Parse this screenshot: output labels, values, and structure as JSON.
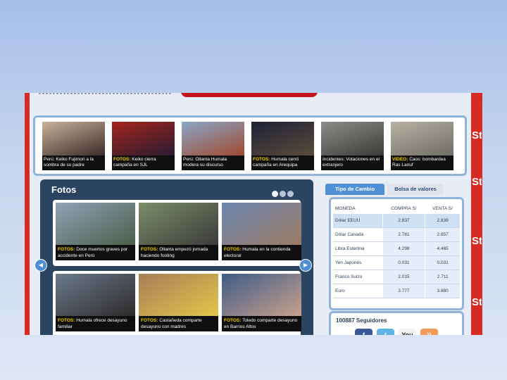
{
  "strip": [
    {
      "text": "Perú: Keiko Fujimori a la sombra de su padre",
      "hl": "",
      "c1": "#c9b39c",
      "c2": "#3b2b2a"
    },
    {
      "text": "Keiko cierra campaña en SJL",
      "hl": "FOTOS:",
      "c1": "#a3241f",
      "c2": "#2a1c30"
    },
    {
      "text": "Perú: Ollanta Humala modera su discurso",
      "hl": "",
      "c1": "#8aa6c9",
      "c2": "#a04a2e"
    },
    {
      "text": "Humala cerró campaña en Arequipa",
      "hl": "FOTOS:",
      "c1": "#1d2236",
      "c2": "#5a4b3b"
    },
    {
      "text": "Incidentes: Votaciones en el extranjero",
      "hl": "",
      "c1": "#8b8f88",
      "c2": "#3b3b38"
    },
    {
      "text": "Caos: bombardea Ras Lanuf",
      "hl": "VIDEO:",
      "c1": "#b8b2a5",
      "c2": "#6f6d66"
    }
  ],
  "side_letters": [
    "St",
    "St",
    "St",
    "St"
  ],
  "fotos": {
    "title": "Fotos",
    "items": [
      {
        "hl": "FOTOS:",
        "text": "Doce muertos graves por accidente en Perú",
        "c1": "#8fa3b5",
        "c2": "#4c5e4a"
      },
      {
        "hl": "FOTOS:",
        "text": "Ollanta empezó jornada haciendo footing",
        "c1": "#7b8d69",
        "c2": "#3b3b3b"
      },
      {
        "hl": "FOTOS:",
        "text": "Humala en la contienda electoral",
        "c1": "#6c87b2",
        "c2": "#9b7a62"
      },
      {
        "hl": "FOTOS:",
        "text": "Humala ofrece desayuno familiar",
        "c1": "#6b7a8c",
        "c2": "#2e2a2a"
      },
      {
        "hl": "FOTOS:",
        "text": "Castañeda comparte desayuno con madres",
        "c1": "#a57f58",
        "c2": "#e2c64a"
      },
      {
        "hl": "FOTOS:",
        "text": "Toledo comparte desayuno en Barrios Altos",
        "c1": "#3e5c88",
        "c2": "#c8a08c"
      }
    ]
  },
  "exchange": {
    "tabs": [
      "Tipo de Cambio",
      "Bolsa de valores"
    ],
    "headers": [
      "MONEDA",
      "COMPRA S/",
      "VENTA S/"
    ],
    "rows": [
      [
        "Dólar EEUU",
        "2.837",
        "2.839"
      ],
      [
        "Dólar Canadá",
        "2.781",
        "2.857"
      ],
      [
        "Libra Esterlina",
        "4.298",
        "4.465"
      ],
      [
        "Yen Japonés",
        "0.031",
        "0.031"
      ],
      [
        "Franco Suizo",
        "2.015",
        "2.711"
      ],
      [
        "Euro",
        "3.777",
        "3.880"
      ]
    ]
  },
  "social": {
    "title": "100887 Seguidores",
    "youtube": "You"
  },
  "colors": {
    "accent_red": "#d62a23",
    "panel_navy": "#2a4462",
    "frame_blue": "#8fb3d9"
  }
}
